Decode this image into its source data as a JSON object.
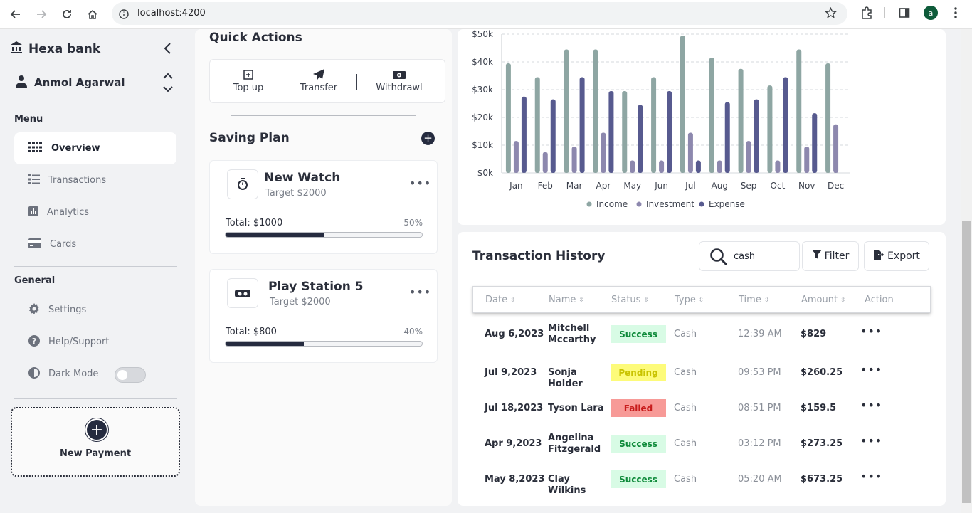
{
  "browser": {
    "url": "localhost:4200",
    "profile_initial": "a"
  },
  "sidebar": {
    "brand": "Hexa bank",
    "user_name": "Anmol Agarwal",
    "menu_label": "Menu",
    "menu_items": [
      {
        "label": "Overview",
        "icon": "grid-icon",
        "active": true
      },
      {
        "label": "Transactions",
        "icon": "list-icon",
        "active": false
      },
      {
        "label": "Analytics",
        "icon": "bar-chart-icon",
        "active": false
      },
      {
        "label": "Cards",
        "icon": "card-icon",
        "active": false
      }
    ],
    "general_label": "General",
    "general_items": [
      {
        "label": "Settings",
        "icon": "gear-icon"
      },
      {
        "label": "Help/Support",
        "icon": "help-icon"
      },
      {
        "label": "Dark Mode",
        "icon": "contrast-icon"
      }
    ],
    "dark_mode_on": false,
    "new_payment_label": "New Payment"
  },
  "quick_actions": {
    "title": "Quick Actions",
    "items": [
      {
        "label": "Top up",
        "icon": "plus-square-icon"
      },
      {
        "label": "Transfer",
        "icon": "paper-plane-icon"
      },
      {
        "label": "Withdrawl",
        "icon": "money-icon"
      }
    ]
  },
  "saving_plan": {
    "title": "Saving Plan",
    "plans": [
      {
        "name": "New Watch",
        "target": "Target $2000",
        "total": "Total: $1000",
        "percent_label": "50%",
        "progress": 0.5,
        "icon": "stopwatch-icon"
      },
      {
        "name": "Play Station 5",
        "target": "Target $2000",
        "total": "Total: $800",
        "percent_label": "40%",
        "progress": 0.4,
        "icon": "vr-headset-icon"
      }
    ]
  },
  "chart_data": {
    "type": "bar",
    "categories": [
      "Jan",
      "Feb",
      "Mar",
      "Apr",
      "May",
      "Jun",
      "Jul",
      "Aug",
      "Sep",
      "Oct",
      "Nov",
      "Dec"
    ],
    "series": [
      {
        "name": "Income",
        "color": "#8ea6a3",
        "values": [
          39500,
          34500,
          44500,
          44500,
          29500,
          34500,
          49500,
          41500,
          37500,
          31500,
          44500,
          39500
        ]
      },
      {
        "name": "Investment",
        "color": "#8d88ae",
        "values": [
          11500,
          7500,
          9500,
          14500,
          4500,
          4500,
          14500,
          4500,
          11500,
          4500,
          9500,
          17500
        ]
      },
      {
        "name": "Expense",
        "color": "#575a8f",
        "values": [
          27500,
          26500,
          34500,
          29500,
          24500,
          29500,
          4500,
          25500,
          26500,
          34500,
          21500,
          0
        ]
      }
    ],
    "ylim": [
      0,
      50000
    ],
    "y_ticks": [
      "$0k",
      "$10k",
      "$20k",
      "$30k",
      "$40k",
      "$50k"
    ],
    "grid": true,
    "legend": "bottom"
  },
  "history": {
    "title": "Transaction History",
    "search_value": "cash",
    "filter_label": "Filter",
    "export_label": "Export",
    "columns": [
      "Date",
      "Name",
      "Status",
      "Type",
      "Time",
      "Amount",
      "Action"
    ],
    "rows": [
      {
        "date": "Aug 6,2023",
        "name": "Mitchell Mccarthy",
        "status": "Success",
        "type": "Cash",
        "time": "12:39 AM",
        "amount": "$829"
      },
      {
        "date": "Jul 9,2023",
        "name": "Sonja Holder",
        "status": "Pending",
        "type": "Cash",
        "time": "09:53 PM",
        "amount": "$260.25"
      },
      {
        "date": "Jul 18,2023",
        "name": "Tyson Lara",
        "status": "Failed",
        "type": "Cash",
        "time": "08:51 PM",
        "amount": "$159.5"
      },
      {
        "date": "Apr 9,2023",
        "name": "Angelina Fitzgerald",
        "status": "Success",
        "type": "Cash",
        "time": "03:12 PM",
        "amount": "$273.25"
      },
      {
        "date": "May 8,2023",
        "name": "Clay Wilkins",
        "status": "Success",
        "type": "Cash",
        "time": "05:20 AM",
        "amount": "$673.25"
      }
    ],
    "status_colors": {
      "Success": {
        "bg": "#d8fbe5",
        "fg": "#0e8a3a"
      },
      "Pending": {
        "bg": "#fdfb7a",
        "fg": "#c9c300"
      },
      "Failed": {
        "bg": "#f79a97",
        "fg": "#c71c1c"
      }
    }
  }
}
